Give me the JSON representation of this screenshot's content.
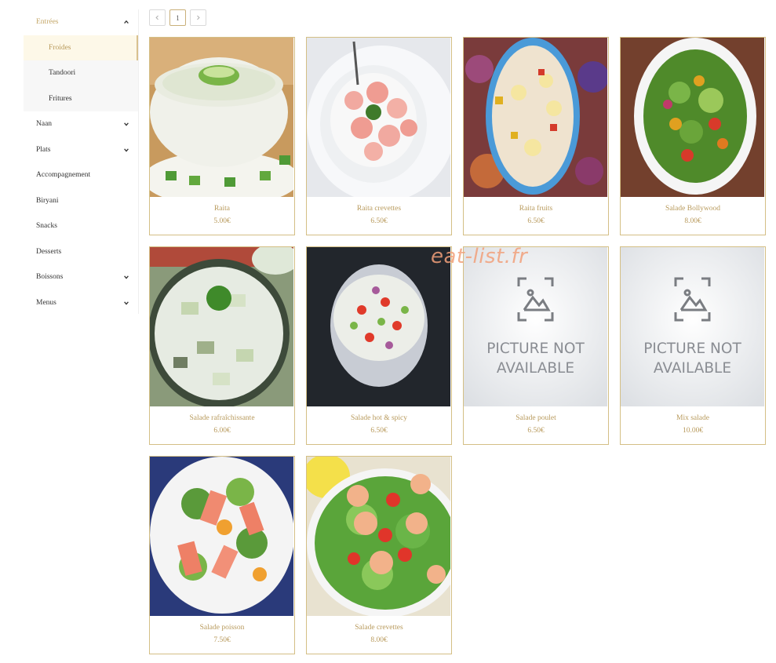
{
  "sidebar": {
    "items": [
      {
        "label": "Entrées",
        "expanded": true,
        "icon": "chevron-up-icon"
      },
      {
        "label": "Froides",
        "sub": true,
        "active": true
      },
      {
        "label": "Tandoori",
        "sub": true
      },
      {
        "label": "Fritures",
        "sub": true
      },
      {
        "label": "Naan",
        "icon": "chevron-down-icon"
      },
      {
        "label": "Plats",
        "icon": "chevron-down-icon"
      },
      {
        "label": "Accompagnement"
      },
      {
        "label": "Biryani"
      },
      {
        "label": "Snacks"
      },
      {
        "label": "Desserts"
      },
      {
        "label": "Boissons",
        "icon": "chevron-down-icon"
      },
      {
        "label": "Menus",
        "icon": "chevron-down-icon"
      }
    ]
  },
  "pagination": {
    "current_page": "1",
    "prev_icon": "chevron-left-icon",
    "next_icon": "chevron-right-icon"
  },
  "products": [
    {
      "name": "Raita",
      "price": "5.00€"
    },
    {
      "name": "Raita crevettes",
      "price": "6.50€"
    },
    {
      "name": "Raita fruits",
      "price": "6.50€"
    },
    {
      "name": "Salade Bollywood",
      "price": "8.00€"
    },
    {
      "name": "Salade rafraîchissante",
      "price": "6.00€"
    },
    {
      "name": "Salade hot & spicy",
      "price": "6.50€"
    },
    {
      "name": "Salade poulet",
      "price": "6.50€",
      "image": "placeholder"
    },
    {
      "name": "Mix salade",
      "price": "10.00€",
      "image": "placeholder"
    },
    {
      "name": "Salade poisson",
      "price": "7.50€"
    },
    {
      "name": "Salade crevettes",
      "price": "8.00€"
    }
  ],
  "placeholder": {
    "line1": "PICTURE NOT",
    "line2": "AVAILABLE"
  },
  "watermark": "eat-list.fr",
  "colors": {
    "accent": "#c5a86a",
    "card_border": "#d4bf85",
    "watermark": "#f2a07a"
  }
}
